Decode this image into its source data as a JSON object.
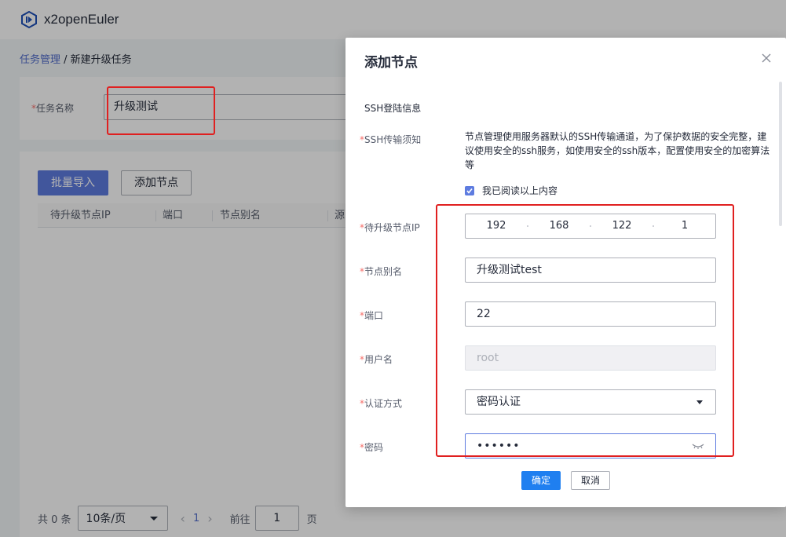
{
  "app": {
    "brand": "x2openEuler",
    "logo_icon": "x2-logo-icon"
  },
  "breadcrumb": {
    "parent": "任务管理",
    "separator": " / ",
    "current": "新建升级任务"
  },
  "task_form": {
    "name_label": "任务名称",
    "name_value": "升级测试"
  },
  "toolbar": {
    "bulk_import": "批量导入",
    "add_node": "添加节点"
  },
  "table": {
    "columns": [
      "待升级节点IP",
      "端口",
      "节点别名",
      "源"
    ]
  },
  "pagination": {
    "total": "共 0 条",
    "page_size": "10条/页",
    "current_page": "1",
    "goto_label": "前往",
    "goto_value": "1",
    "unit": "页"
  },
  "dialog": {
    "title": "添加节点",
    "section": "SSH登陆信息",
    "notice_label": "SSH传输须知",
    "notice_text": "节点管理使用服务器默认的SSH传输通道，为了保护数据的安全完整，建议使用安全的ssh服务，如使用安全的ssh版本，配置使用安全的加密算法等",
    "read_checkbox": "我已阅读以上内容",
    "read_checked": true,
    "fields": {
      "ip": {
        "label": "待升级节点IP",
        "octets": [
          "192",
          "168",
          "122",
          "1"
        ]
      },
      "alias": {
        "label": "节点别名",
        "value": "升级测试test"
      },
      "port": {
        "label": "端口",
        "value": "22"
      },
      "username": {
        "label": "用户名",
        "value": "root"
      },
      "auth": {
        "label": "认证方式",
        "value": "密码认证"
      },
      "password": {
        "label": "密码",
        "value": "••••••"
      }
    },
    "confirm": "确定",
    "cancel": "取消"
  },
  "colors": {
    "primary": "#5e7ce0",
    "confirm": "#1f7ff0",
    "highlight": "#e02020",
    "required": "#f66f6a",
    "link": "#526ecc"
  }
}
